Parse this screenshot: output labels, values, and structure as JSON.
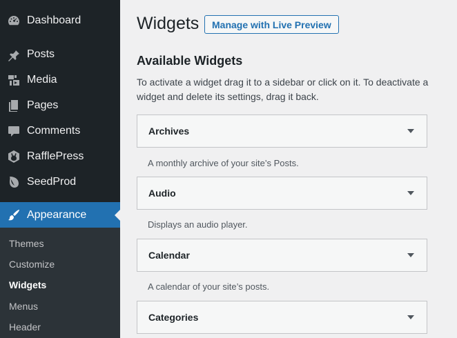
{
  "sidebar": {
    "items": [
      {
        "label": "Dashboard",
        "icon": "dashboard-icon"
      },
      {
        "label": "Posts",
        "icon": "pin-icon"
      },
      {
        "label": "Media",
        "icon": "media-icon"
      },
      {
        "label": "Pages",
        "icon": "pages-icon"
      },
      {
        "label": "Comments",
        "icon": "comment-icon"
      },
      {
        "label": "RafflePress",
        "icon": "rafflepress-icon"
      },
      {
        "label": "SeedProd",
        "icon": "seedprod-icon"
      },
      {
        "label": "Appearance",
        "icon": "brush-icon"
      }
    ],
    "submenu": [
      "Themes",
      "Customize",
      "Widgets",
      "Menus",
      "Header"
    ],
    "active_color": "#2271b1"
  },
  "main": {
    "title": "Widgets",
    "preview_button": "Manage with Live Preview",
    "section_title": "Available Widgets",
    "section_desc": "To activate a widget drag it to a sidebar or click on it. To deactivate a widget and delete its settings, drag it back.",
    "widgets": [
      {
        "title": "Archives",
        "desc": "A monthly archive of your site’s Posts."
      },
      {
        "title": "Audio",
        "desc": "Displays an audio player."
      },
      {
        "title": "Calendar",
        "desc": "A calendar of your site’s posts."
      },
      {
        "title": "Categories",
        "desc": ""
      }
    ]
  }
}
